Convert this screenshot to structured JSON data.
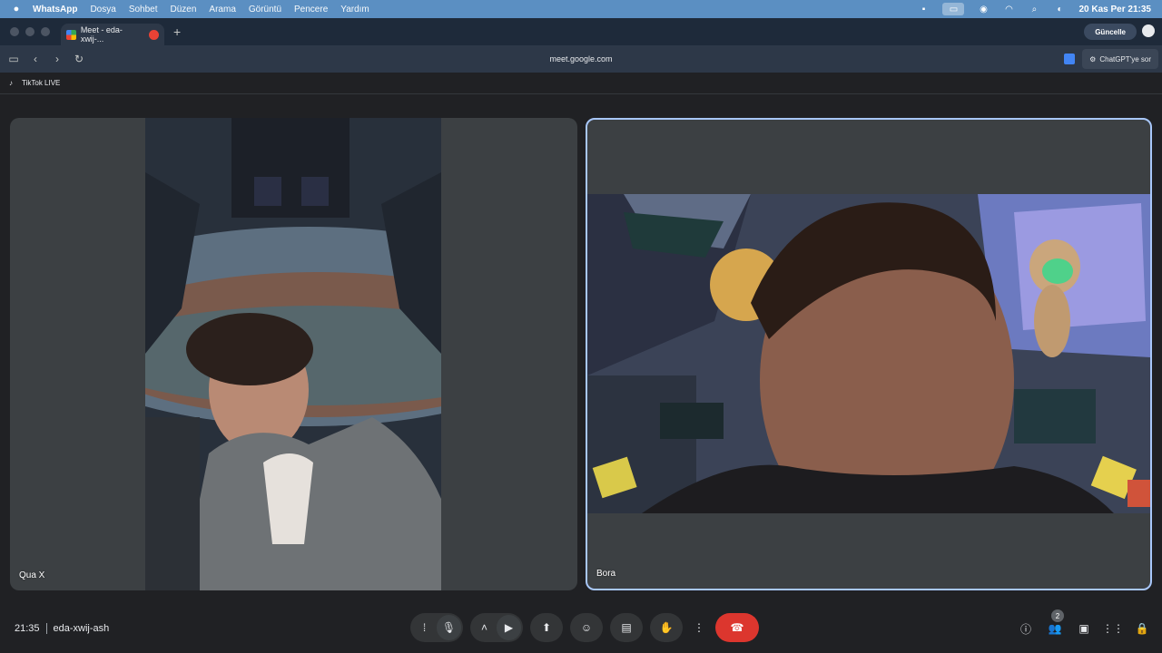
{
  "menubar": {
    "app_name": "WhatsApp",
    "items": [
      "Dosya",
      "Sohbet",
      "Düzen",
      "Arama",
      "Görüntü",
      "Pencere",
      "Yardım"
    ],
    "clock": "20 Kas Per  21:35"
  },
  "browser": {
    "tab_title": "Meet - eda-xwij-...",
    "new_tab": "+",
    "update_label": "Güncelle",
    "url": "meet.google.com",
    "chatgpt_label": "ChatGPT'ye sor",
    "bookmark": "TikTok LIVE"
  },
  "participants": [
    {
      "name": "Qua X"
    },
    {
      "name": "Bora"
    }
  ],
  "meeting": {
    "time": "21:35",
    "code": "eda-xwij-ash",
    "people_count": "2"
  },
  "icons": {
    "apple": "",
    "back": "‹",
    "forward": "›",
    "reload": "↻",
    "sidebar": "▭"
  },
  "colors": {
    "menubar": "#5b8fc2",
    "end_call": "#dc362e",
    "active_border": "#a8c7fa"
  }
}
